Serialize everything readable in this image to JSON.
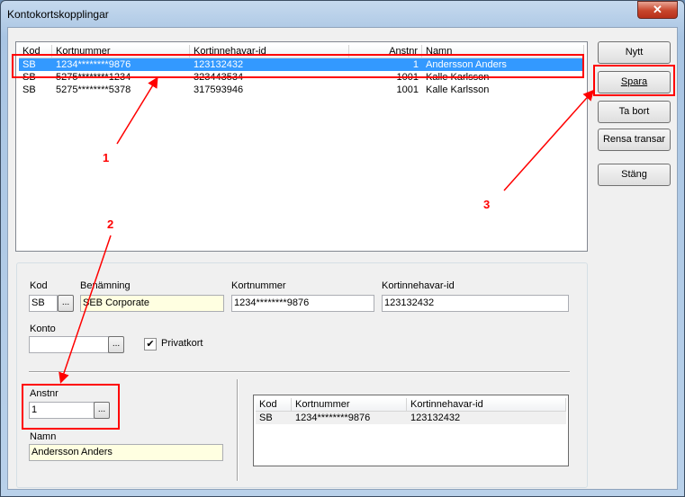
{
  "window": {
    "title": "Kontokortskopplingar",
    "close_icon": "close-icon"
  },
  "cards_list": {
    "columns": [
      "Kod",
      "Kortnummer",
      "Kortinnehavar-id",
      "Anstnr",
      "Namn"
    ],
    "rows": [
      {
        "kod": "SB",
        "kortnummer": "1234********9876",
        "kortinnehavar_id": "123132432",
        "anstnr": "1",
        "namn": "Andersson Anders",
        "selected": true
      },
      {
        "kod": "SB",
        "kortnummer": "5275********1234",
        "kortinnehavar_id": "323443534",
        "anstnr": "1001",
        "namn": "Kalle Karlsson",
        "selected": false
      },
      {
        "kod": "SB",
        "kortnummer": "5275********5378",
        "kortinnehavar_id": "317593946",
        "anstnr": "1001",
        "namn": "Kalle Karlsson",
        "selected": false
      }
    ]
  },
  "buttons": {
    "nytt": "Nytt",
    "spara": "Spara",
    "ta_bort": "Ta bort",
    "rensa": "Rensa transar",
    "stang": "Stäng"
  },
  "form": {
    "kod_label": "Kod",
    "kod_value": "SB",
    "benamning_label": "Benämning",
    "benamning_value": "SEB Corporate",
    "kortnummer_label": "Kortnummer",
    "kortnummer_value": "1234********9876",
    "kortinnehavar_label": "Kortinnehavar-id",
    "kortinnehavar_value": "123132432",
    "konto_label": "Konto",
    "konto_value": "",
    "privatkort_label": "Privatkort",
    "privatkort_checked": true,
    "anstnr_label": "Anstnr",
    "anstnr_value": "1",
    "namn_label": "Namn",
    "namn_value": "Andersson Anders",
    "browse_label": "..."
  },
  "employee_cards": {
    "columns": [
      "Kod",
      "Kortnummer",
      "Kortinnehavar-id"
    ],
    "rows": [
      {
        "kod": "SB",
        "kortnummer": "1234********9876",
        "kortinnehavar_id": "123132432"
      }
    ]
  },
  "annotations": {
    "labels": [
      "1",
      "2",
      "3"
    ],
    "color": "#ff0000"
  }
}
